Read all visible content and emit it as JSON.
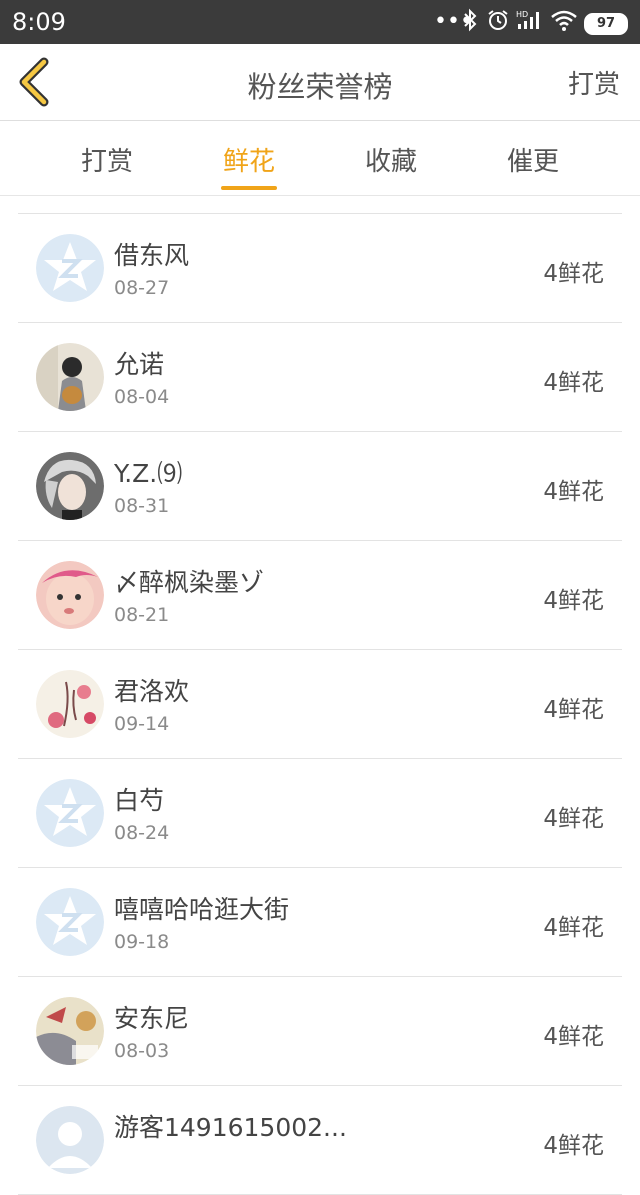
{
  "status_bar": {
    "time": "8:09",
    "icons": [
      "more-dots-icon",
      "bluetooth-icon",
      "alarm-icon",
      "hd-signal-icon",
      "wifi-icon"
    ],
    "battery": "97"
  },
  "header": {
    "back_icon": "chevron-left-icon",
    "title": "粉丝荣誉榜",
    "right_action": "打赏",
    "accent": "#f0a419"
  },
  "tabs": [
    {
      "label": "打赏",
      "active": false
    },
    {
      "label": "鲜花",
      "active": true
    },
    {
      "label": "收藏",
      "active": false
    },
    {
      "label": "催更",
      "active": false
    }
  ],
  "fans": [
    {
      "name": "借东风",
      "date": "08-27",
      "amount": "4鲜花",
      "avatar": "default-avatar"
    },
    {
      "name": "允诺",
      "date": "08-04",
      "amount": "4鲜花",
      "avatar": "photo-avatar"
    },
    {
      "name": "Y.Z.⑼",
      "date": "08-31",
      "amount": "4鲜花",
      "avatar": "photo-avatar"
    },
    {
      "name": "〆醉枫染墨ゾ",
      "date": "08-21",
      "amount": "4鲜花",
      "avatar": "photo-avatar"
    },
    {
      "name": "君洛欢",
      "date": "09-14",
      "amount": "4鲜花",
      "avatar": "photo-avatar"
    },
    {
      "name": "白芍",
      "date": "08-24",
      "amount": "4鲜花",
      "avatar": "default-avatar"
    },
    {
      "name": "嘻嘻哈哈逛大街",
      "date": "09-18",
      "amount": "4鲜花",
      "avatar": "default-avatar"
    },
    {
      "name": "安东尼",
      "date": "08-03",
      "amount": "4鲜花",
      "avatar": "photo-avatar"
    },
    {
      "name": "游客1491615002...",
      "date": "",
      "amount": "4鲜花",
      "avatar": "default-avatar"
    }
  ]
}
